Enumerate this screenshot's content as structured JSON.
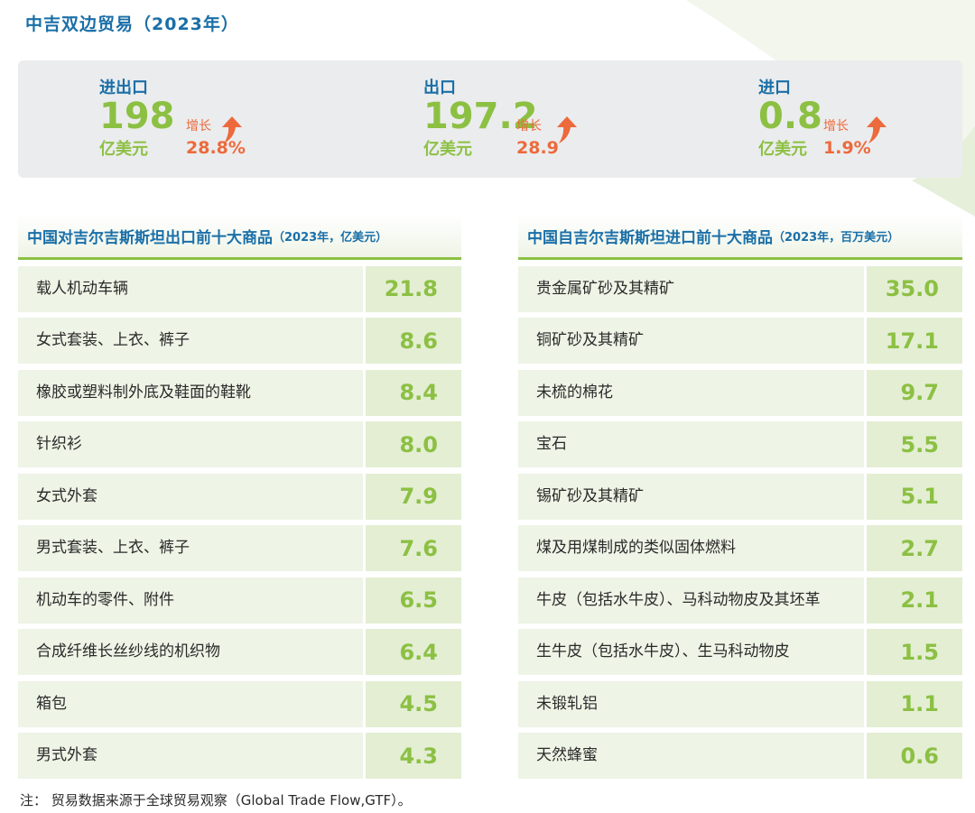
{
  "section_title": "中吉双边贸易（2023年）",
  "summary": {
    "total": {
      "label": "进出口",
      "value": "198",
      "unit": "亿美元",
      "growth_label": "增长",
      "growth": "28.8%"
    },
    "export": {
      "label": "出口",
      "value": "197.2",
      "unit": "亿美元",
      "growth_label": "增长",
      "growth": "28.9"
    },
    "import": {
      "label": "进口",
      "value": "0.8",
      "unit": "亿美元",
      "growth_label": "增长",
      "growth": "1.9%"
    }
  },
  "export_table": {
    "title": "中国对吉尔吉斯斯坦出口前十大商品",
    "note": "（2023年，亿美元）",
    "rows": [
      {
        "name": "载人机动车辆",
        "value": "21.8"
      },
      {
        "name": "女式套装、上衣、裤子",
        "value": "8.6"
      },
      {
        "name": "橡胶或塑料制外底及鞋面的鞋靴",
        "value": "8.4"
      },
      {
        "name": "针织衫",
        "value": "8.0"
      },
      {
        "name": "女式外套",
        "value": "7.9"
      },
      {
        "name": "男式套装、上衣、裤子",
        "value": "7.6"
      },
      {
        "name": "机动车的零件、附件",
        "value": "6.5"
      },
      {
        "name": "合成纤维长丝纱线的机织物",
        "value": "6.4"
      },
      {
        "name": "箱包",
        "value": "4.5"
      },
      {
        "name": "男式外套",
        "value": "4.3"
      }
    ]
  },
  "import_table": {
    "title": "中国自吉尔吉斯斯坦进口前十大商品",
    "note": "（2023年，百万美元）",
    "rows": [
      {
        "name": "贵金属矿砂及其精矿",
        "value": "35.0"
      },
      {
        "name": "铜矿砂及其精矿",
        "value": "17.1"
      },
      {
        "name": "未梳的棉花",
        "value": "9.7"
      },
      {
        "name": "宝石",
        "value": "5.5"
      },
      {
        "name": "锡矿砂及其精矿",
        "value": "5.1"
      },
      {
        "name": "煤及用煤制成的类似固体燃料",
        "value": "2.7"
      },
      {
        "name": "牛皮（包括水牛皮）、马科动物皮及其坯革",
        "value": "2.1"
      },
      {
        "name": "生牛皮（包括水牛皮）、生马科动物皮",
        "value": "1.5"
      },
      {
        "name": "未锻轧铝",
        "value": "1.1"
      },
      {
        "name": "天然蜂蜜",
        "value": "0.6"
      }
    ]
  },
  "footnote": "注： 贸易数据来源于全球贸易观察（Global Trade Flow,GTF）。",
  "colors": {
    "title_blue": "#1a6fa8",
    "value_green": "#8cc043",
    "growth_orange": "#ec6a3c",
    "row_light": "#eef4e6",
    "row_value": "#e3eed3",
    "summary_bg": "#ebeced"
  }
}
